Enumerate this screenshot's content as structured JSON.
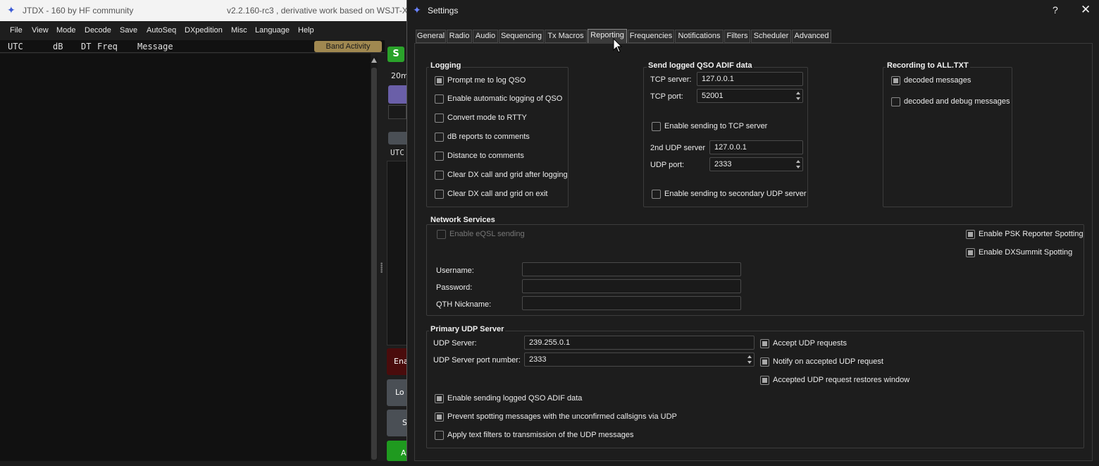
{
  "main_window": {
    "title": "JTDX - 160  by HF community",
    "version": "v2.2.160-rc3 , derivative work based on WSJT-X",
    "menu": [
      "File",
      "View",
      "Mode",
      "Decode",
      "Save",
      "AutoSeq",
      "DXpedition",
      "Misc",
      "Language",
      "Help"
    ],
    "columns": {
      "utc": "UTC",
      "db": "dB",
      "dt": "DT",
      "freq": "Freq",
      "message": "Message"
    },
    "band_activity": "Band Activity",
    "s_button": "S",
    "band_label": "20m",
    "utc_fragment": "UTC",
    "ena_fragment": "Ena",
    "log_fragment": "Lo",
    "s_fragment": "S",
    "a_fragment": "A"
  },
  "dialog": {
    "title": "Settings",
    "help_icon": "?",
    "close_icon": "✕",
    "tabs": [
      "General",
      "Radio",
      "Audio",
      "Sequencing",
      "Tx Macros",
      "Reporting",
      "Frequencies",
      "Notifications",
      "Filters",
      "Scheduler",
      "Advanced"
    ],
    "active_tab": "Reporting",
    "logging": {
      "title": "Logging",
      "items": [
        {
          "label": "Prompt me to log QSO",
          "checked": true
        },
        {
          "label": "Enable automatic logging of QSO",
          "checked": false
        },
        {
          "label": "Convert mode to RTTY",
          "checked": false
        },
        {
          "label": "dB reports to comments",
          "checked": false
        },
        {
          "label": "Distance to comments",
          "checked": false
        },
        {
          "label": "Clear DX call and grid after logging",
          "checked": false
        },
        {
          "label": "Clear DX call and grid on exit",
          "checked": false
        }
      ]
    },
    "adif": {
      "title": "Send logged QSO ADIF data",
      "tcp_server_label": "TCP server:",
      "tcp_server": "127.0.0.1",
      "tcp_port_label": "TCP port:",
      "tcp_port": "52001",
      "enable_tcp": {
        "label": "Enable sending to TCP server",
        "checked": false
      },
      "udp2_server_label": "2nd UDP server",
      "udp2_server": "127.0.0.1",
      "udp_port_label": "UDP port:",
      "udp_port": "2333",
      "enable_udp2": {
        "label": "Enable sending to secondary UDP server",
        "checked": false
      }
    },
    "recording": {
      "title": "Recording to ALL.TXT",
      "decoded": {
        "label": "decoded messages",
        "checked": true
      },
      "debug": {
        "label": "decoded and debug messages",
        "checked": false
      }
    },
    "network": {
      "title": "Network Services",
      "eqsl": {
        "label": "Enable eQSL sending",
        "checked": false
      },
      "psk": {
        "label": "Enable PSK Reporter Spotting",
        "checked": true
      },
      "dxsummit": {
        "label": "Enable DXSummit Spotting",
        "checked": true
      },
      "username_label": "Username:",
      "username": "",
      "password_label": "Password:",
      "password": "",
      "qth_label": "QTH Nickname:",
      "qth": ""
    },
    "primary_udp": {
      "title": "Primary UDP Server",
      "server_label": "UDP Server:",
      "server": "239.255.0.1",
      "port_label": "UDP Server port number:",
      "port": "2333",
      "accept": {
        "label": "Accept UDP requests",
        "checked": true
      },
      "notify": {
        "label": "Notify on accepted UDP request",
        "checked": true
      },
      "restores": {
        "label": "Accepted UDP request restores window",
        "checked": true
      },
      "adif": {
        "label": "Enable sending logged QSO ADIF data",
        "checked": true
      },
      "prevent": {
        "label": "Prevent spotting messages with the unconfirmed callsigns via UDP",
        "checked": true
      },
      "filters": {
        "label": "Apply text filters to transmission of the UDP messages",
        "checked": false
      }
    }
  }
}
